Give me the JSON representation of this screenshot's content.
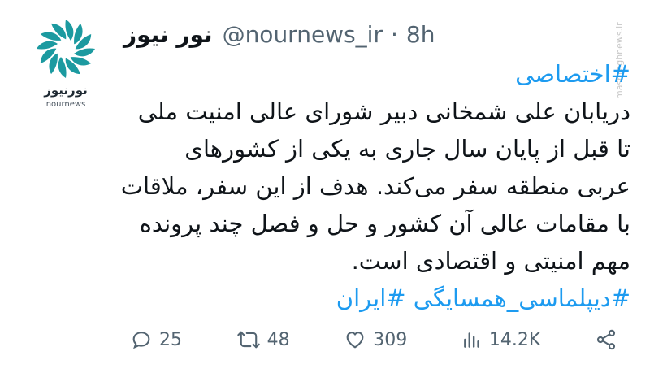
{
  "account": {
    "display_name": "نور نیوز",
    "handle": "@nournews_ir",
    "separator": "·",
    "time": "8h",
    "logo_text_fa": "نورنیوز",
    "logo_text_en": "nournews"
  },
  "watermark": "mashreghnews.ir",
  "tweet": {
    "tag_top": "#اختصاصی",
    "lines": [
      "دریابان علی شمخانی دبیر شورای عالی امنیت ملی",
      "تا قبل از پایان سال جاری به یکی از کشورهای",
      "عربی منطقه سفر می‌کند. هدف از این سفر، ملاقات",
      "با مقامات عالی آن کشور و حل و فصل چند پرونده",
      "مهم امنیتی و اقتصادی است."
    ],
    "tags_bottom": "#دیپلماسی_همسایگی #ایران"
  },
  "actions": {
    "replies": "25",
    "retweets": "48",
    "likes": "309",
    "views": "14.2K",
    "icons": [
      "reply-icon",
      "retweet-icon",
      "like-icon",
      "views-icon",
      "share-icon"
    ]
  },
  "colors": {
    "link": "#1d9bf0",
    "muted": "#536471",
    "logo_teal": "#1c9aa0"
  }
}
